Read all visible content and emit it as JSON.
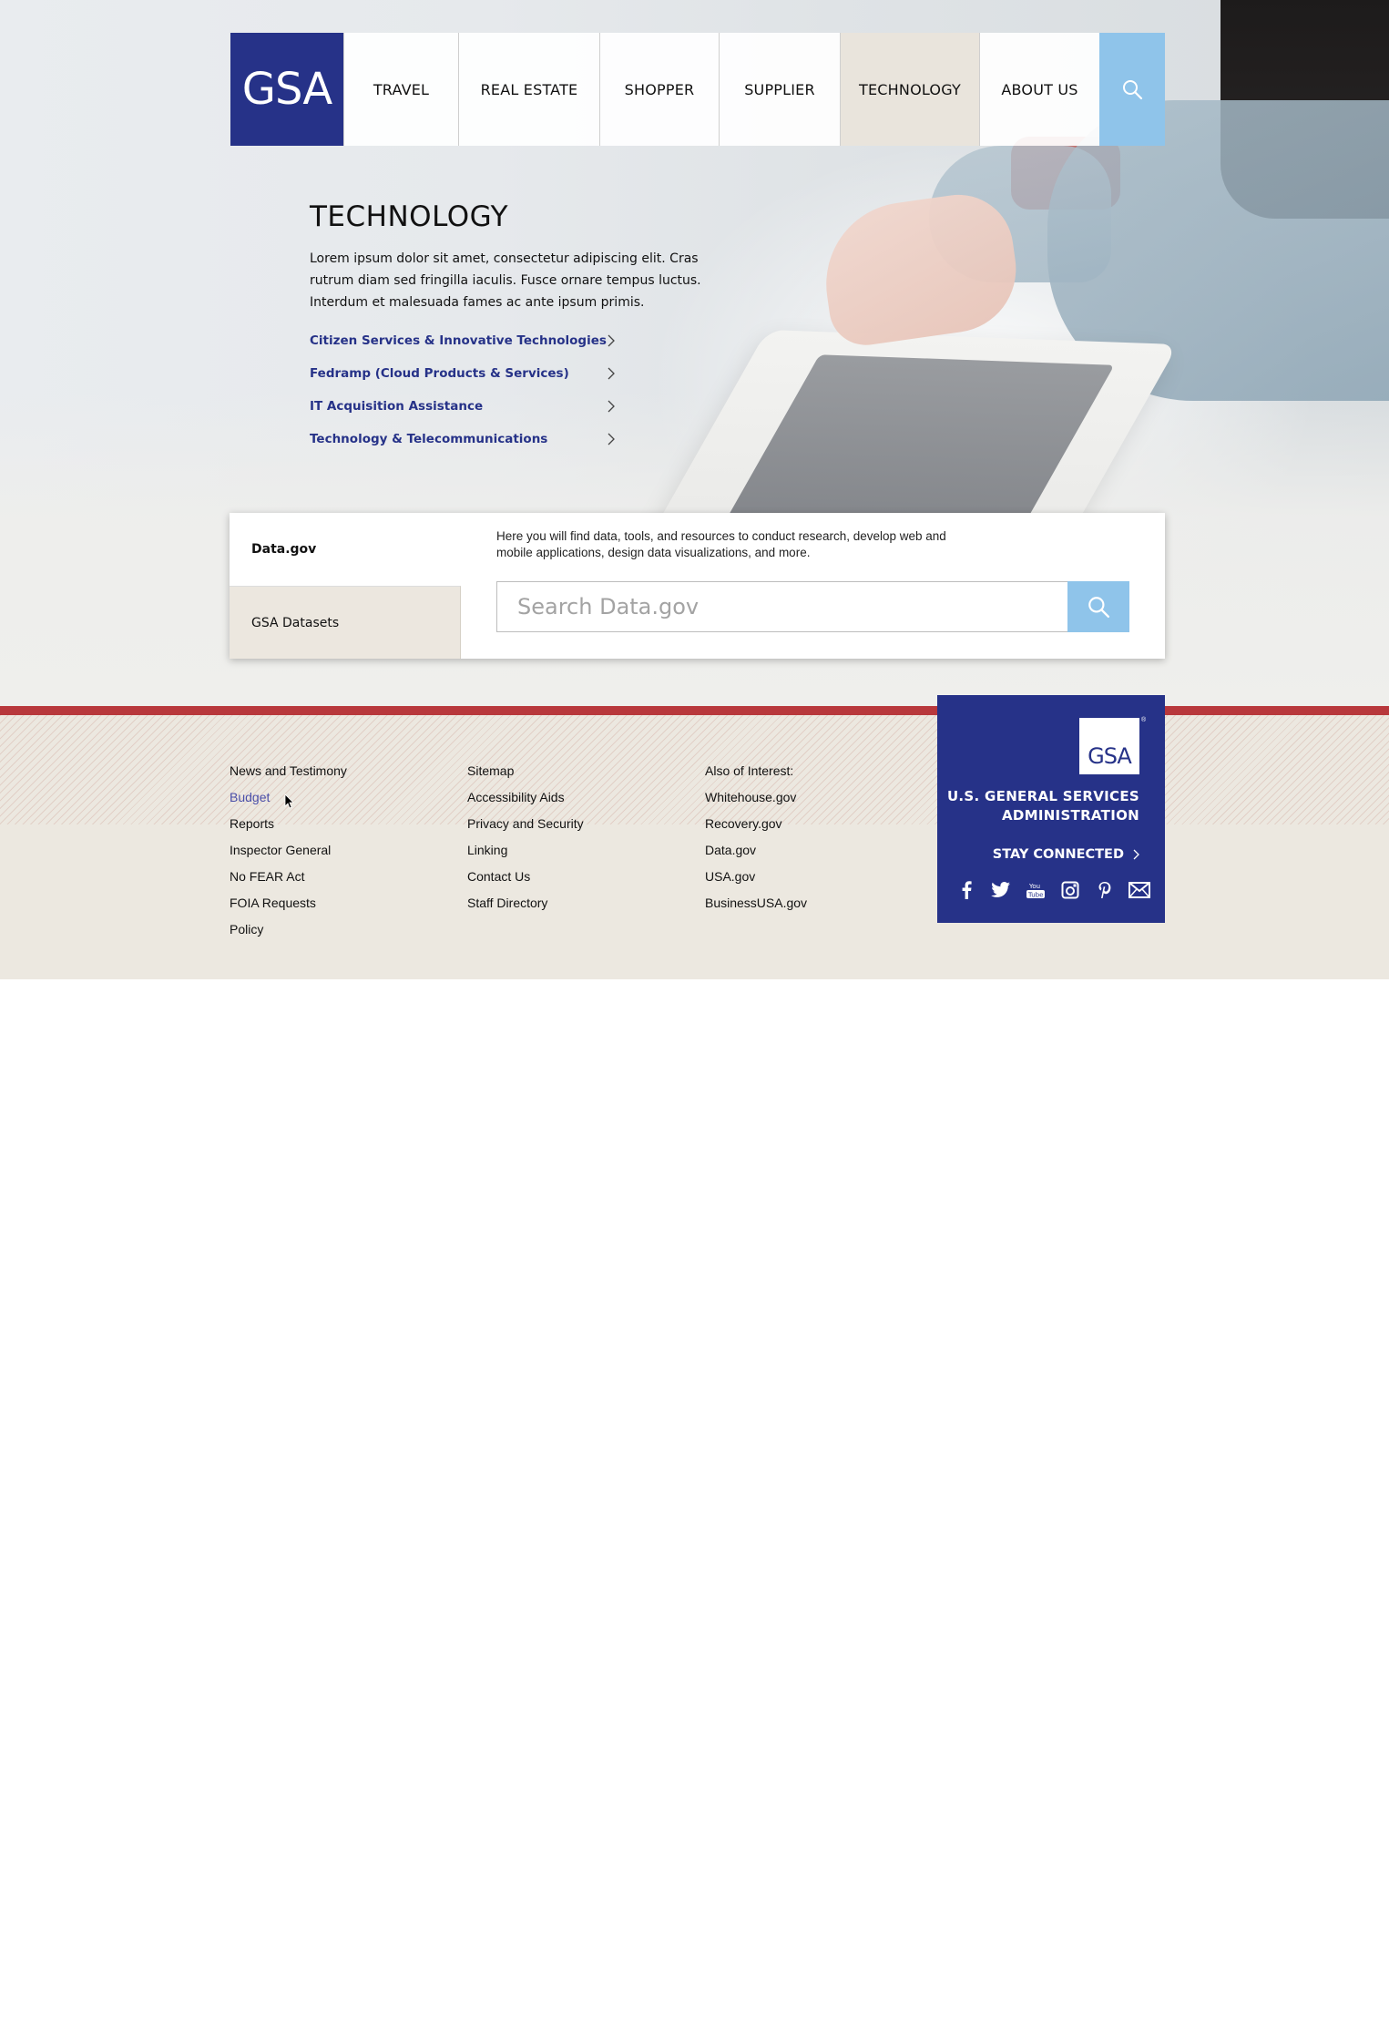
{
  "logo": {
    "text": "GSA"
  },
  "nav": {
    "items": [
      {
        "label": "TRAVEL"
      },
      {
        "label": "REAL ESTATE"
      },
      {
        "label": "SHOPPER"
      },
      {
        "label": "SUPPLIER"
      },
      {
        "label": "TECHNOLOGY"
      },
      {
        "label": "ABOUT US"
      }
    ],
    "active": "TECHNOLOGY",
    "search_icon": "search-icon"
  },
  "intro": {
    "title": "TECHNOLOGY",
    "body": "Lorem ipsum dolor sit amet, consectetur adipiscing elit. Cras rutrum diam sed fringilla iaculis. Fusce ornare tempus luctus. Interdum et malesuada fames ac ante ipsum primis.",
    "links": [
      {
        "label": "Citizen Services & Innovative Technologies"
      },
      {
        "label": "Fedramp (Cloud Products & Services)"
      },
      {
        "label": "IT Acquisition Assistance"
      },
      {
        "label": "Technology & Telecommunications"
      }
    ]
  },
  "databox": {
    "tabs": [
      {
        "label": "Data.gov"
      },
      {
        "label": "GSA Datasets"
      }
    ],
    "selected_tab": "Data.gov",
    "description": "Here you will find data, tools, and resources to conduct research, develop web and mobile applications, design data visualizations, and more.",
    "search_placeholder": "Search Data.gov"
  },
  "footer": {
    "col1": [
      "News and Testimony",
      "Budget",
      "Reports",
      "Inspector General",
      "No FEAR Act",
      "FOIA Requests",
      "Policy"
    ],
    "col2": [
      "Sitemap",
      "Accessibility Aids",
      "Privacy and Security",
      "Linking",
      "Contact Us",
      "Staff Directory"
    ],
    "col3": [
      "Also of Interest:",
      "Whitehouse.gov",
      "Recovery.gov",
      "Data.gov",
      "USA.gov",
      "BusinessUSA.gov"
    ],
    "hovered": "Budget"
  },
  "brand": {
    "logo_text": "GSA",
    "registered": "®",
    "name_line1": "U.S. GENERAL SERVICES",
    "name_line2": "ADMINISTRATION",
    "stay_connected": "STAY CONNECTED",
    "social_icons": [
      "facebook-icon",
      "twitter-icon",
      "youtube-icon",
      "instagram-icon",
      "pinterest-icon",
      "email-icon"
    ]
  },
  "colors": {
    "brand_blue": "#263288",
    "accent_light_blue": "#8fc4ea",
    "footer_red": "#b8383c",
    "footer_bg": "#ece8e0",
    "active_nav": "#e9e4dc"
  }
}
